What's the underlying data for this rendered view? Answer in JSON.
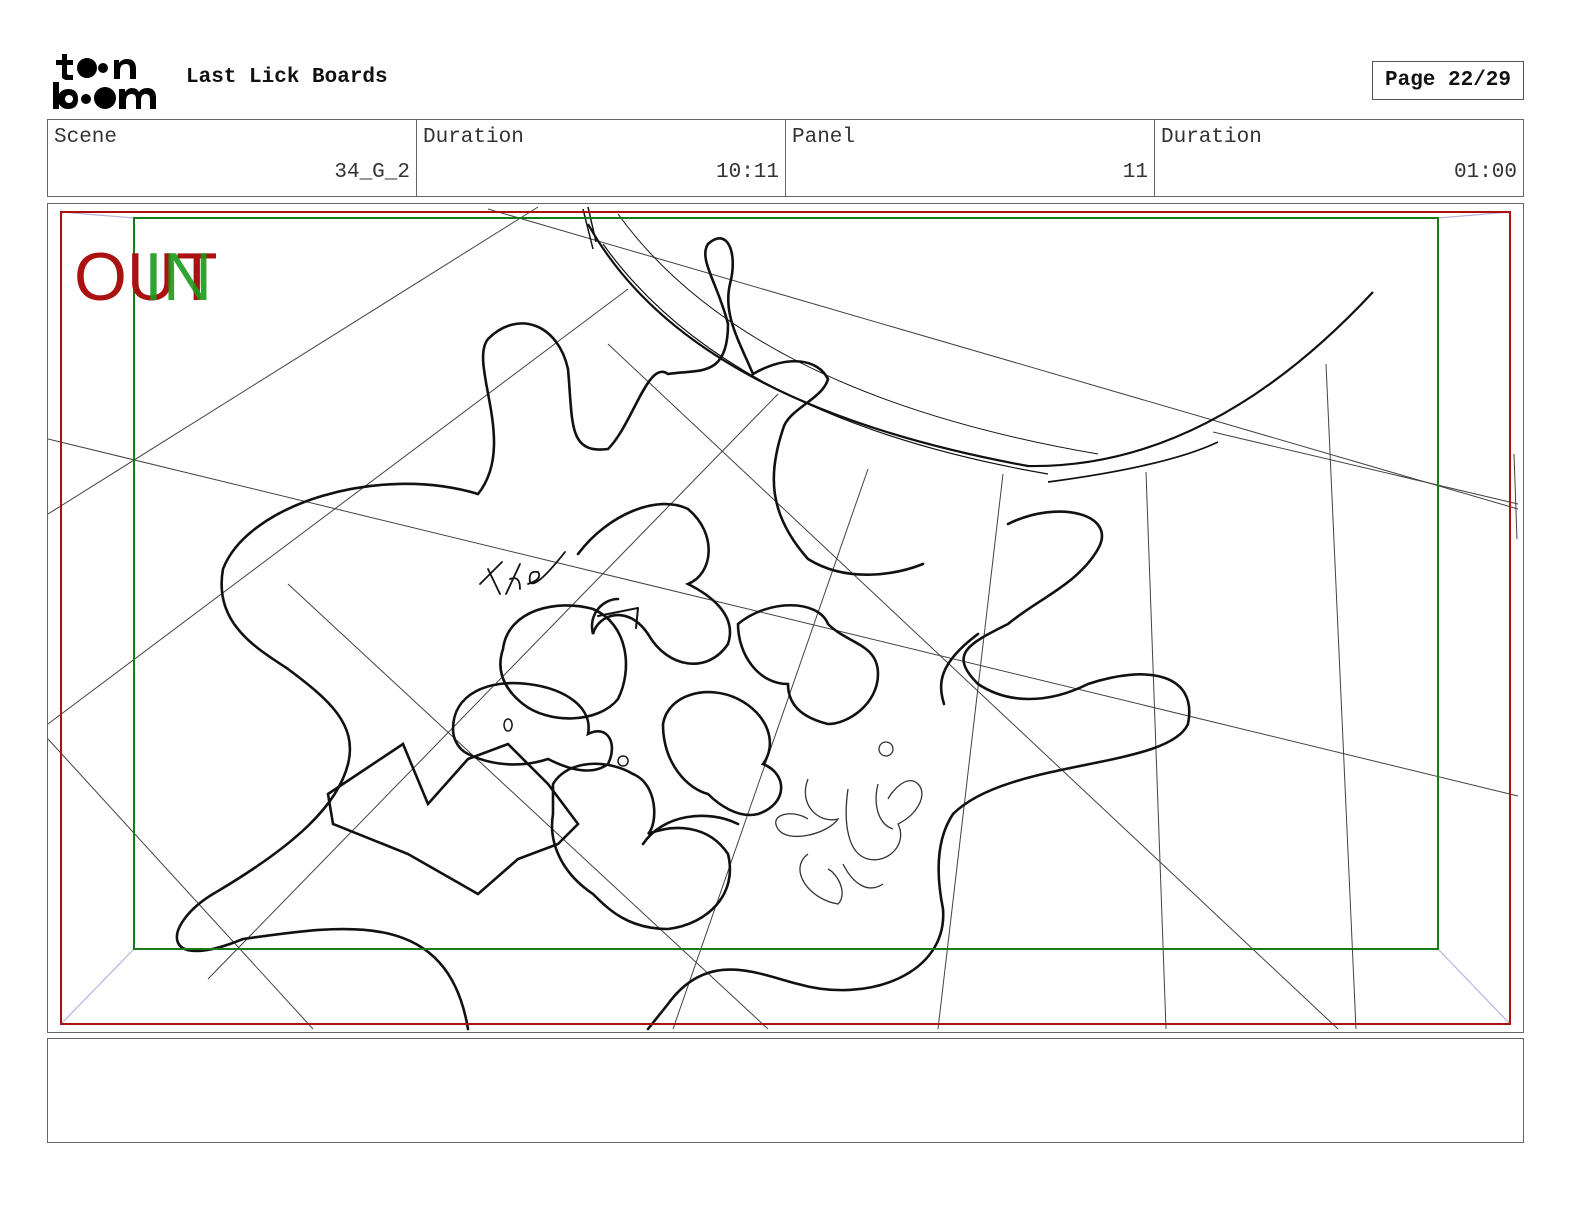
{
  "header": {
    "logo_name": "toon-boom-logo",
    "project_title": "Last Lick Boards",
    "page_label": "Page 22/29"
  },
  "info": {
    "scene_label": "Scene",
    "scene_value": "34_G_2",
    "scene_duration_label": "Duration",
    "scene_duration_value": "10:11",
    "panel_label": "Panel",
    "panel_value": "11",
    "panel_duration_label": "Duration",
    "panel_duration_value": "01:00"
  },
  "panel": {
    "camera_out_label": "OUT",
    "camera_in_label": "IN",
    "sketch_title_word": "The",
    "colors": {
      "out_frame": "#aa1111",
      "in_frame": "#1a7a1a",
      "corner_guides": "#b9b3e0",
      "sketch_ink": "#111111"
    }
  },
  "notes": {
    "text": ""
  }
}
